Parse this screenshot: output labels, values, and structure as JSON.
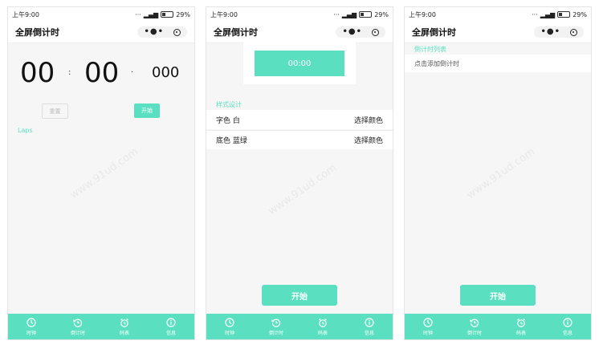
{
  "status": {
    "time": "上午9:00",
    "battery": "29%"
  },
  "nav": {
    "title": "全屏倒计时"
  },
  "screen1": {
    "hours": "00",
    "sep1": ":",
    "minutes": "00",
    "sep2": "·",
    "millis": "000",
    "reset_label": "重置",
    "start_label": "开始",
    "laps_label": "Laps"
  },
  "screen2": {
    "preview_time": "00:00",
    "section_label": "样式设计",
    "rows": [
      {
        "label": "字色 白",
        "action": "选择颜色"
      },
      {
        "label": "底色 蓝绿",
        "action": "选择颜色"
      }
    ],
    "start_label": "开始"
  },
  "screen3": {
    "section_label": "倒计时列表",
    "placeholder": "点击添加倒计时",
    "start_label": "开始"
  },
  "tabs": [
    {
      "label": "时钟",
      "icon": "clock-icon"
    },
    {
      "label": "倒计时",
      "icon": "countdown-icon"
    },
    {
      "label": "码表",
      "icon": "stopwatch-icon"
    },
    {
      "label": "信息",
      "icon": "info-icon"
    }
  ],
  "colors": {
    "accent": "#5ae0c0",
    "background": "#f6f6f6"
  }
}
